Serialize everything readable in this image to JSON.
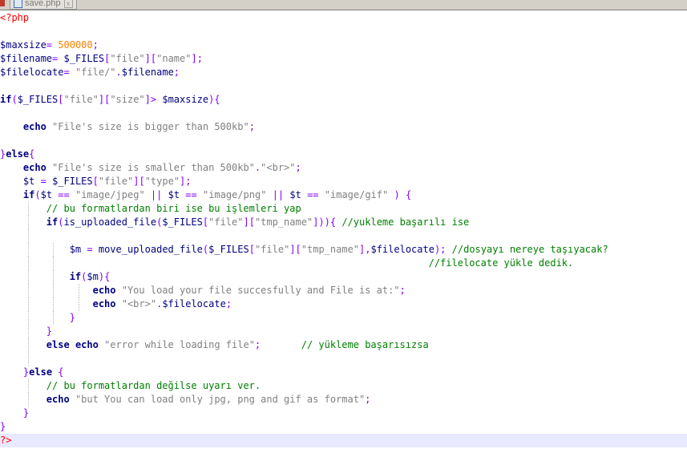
{
  "tab": {
    "filename": "save.php",
    "close_glyph": "x"
  },
  "colors": {
    "tag": "#ff0000",
    "variable": "#000080",
    "operator": "#8000ff",
    "number": "#ff8000",
    "string": "#808080",
    "keyword": "#000080",
    "comment": "#008000",
    "current_line": "#e8e8ff"
  },
  "code": {
    "lines": [
      [
        [
          "tag",
          "<?php"
        ]
      ],
      [],
      [
        [
          "var",
          "$maxsize"
        ],
        [
          "op",
          "="
        ],
        [
          "text",
          " "
        ],
        [
          "num",
          "500000"
        ],
        [
          "op",
          ";"
        ]
      ],
      [
        [
          "var",
          "$filename"
        ],
        [
          "op",
          "="
        ],
        [
          "text",
          " "
        ],
        [
          "var",
          "$_FILES"
        ],
        [
          "op",
          "["
        ],
        [
          "str",
          "\"file\""
        ],
        [
          "op",
          "]["
        ],
        [
          "str",
          "\"name\""
        ],
        [
          "op",
          "];"
        ]
      ],
      [
        [
          "var",
          "$filelocate"
        ],
        [
          "op",
          "="
        ],
        [
          "text",
          " "
        ],
        [
          "str",
          "\"file/\""
        ],
        [
          "op",
          "."
        ],
        [
          "var",
          "$filename"
        ],
        [
          "op",
          ";"
        ]
      ],
      [],
      [
        [
          "kw",
          "if"
        ],
        [
          "op",
          "("
        ],
        [
          "var",
          "$_FILES"
        ],
        [
          "op",
          "["
        ],
        [
          "str",
          "\"file\""
        ],
        [
          "op",
          "]["
        ],
        [
          "str",
          "\"size\""
        ],
        [
          "op",
          "]>"
        ],
        [
          "text",
          " "
        ],
        [
          "var",
          "$maxsize"
        ],
        [
          "op",
          "){"
        ]
      ],
      [],
      [
        [
          "text",
          "    "
        ],
        [
          "kw",
          "echo"
        ],
        [
          "text",
          " "
        ],
        [
          "str",
          "\"File's size is bigger than 500kb\""
        ],
        [
          "op",
          ";"
        ]
      ],
      [],
      [
        [
          "op",
          "}"
        ],
        [
          "kw",
          "else"
        ],
        [
          "op",
          "{"
        ]
      ],
      [
        [
          "text",
          "    "
        ],
        [
          "kw",
          "echo"
        ],
        [
          "text",
          " "
        ],
        [
          "str",
          "\"File's size is smaller than 500kb\""
        ],
        [
          "op",
          "."
        ],
        [
          "str",
          "\"<br>\""
        ],
        [
          "op",
          ";"
        ]
      ],
      [
        [
          "text",
          "    "
        ],
        [
          "var",
          "$t"
        ],
        [
          "text",
          " "
        ],
        [
          "op",
          "="
        ],
        [
          "text",
          " "
        ],
        [
          "var",
          "$_FILES"
        ],
        [
          "op",
          "["
        ],
        [
          "str",
          "\"file\""
        ],
        [
          "op",
          "]["
        ],
        [
          "str",
          "\"type\""
        ],
        [
          "op",
          "];"
        ]
      ],
      [
        [
          "text",
          "    "
        ],
        [
          "kw",
          "if"
        ],
        [
          "op",
          "("
        ],
        [
          "var",
          "$t"
        ],
        [
          "text",
          " "
        ],
        [
          "op",
          "=="
        ],
        [
          "text",
          " "
        ],
        [
          "str",
          "\"image/jpeg\""
        ],
        [
          "text",
          " "
        ],
        [
          "op",
          "||"
        ],
        [
          "text",
          " "
        ],
        [
          "var",
          "$t"
        ],
        [
          "text",
          " "
        ],
        [
          "op",
          "=="
        ],
        [
          "text",
          " "
        ],
        [
          "str",
          "\"image/png\""
        ],
        [
          "text",
          " "
        ],
        [
          "op",
          "||"
        ],
        [
          "text",
          " "
        ],
        [
          "var",
          "$t"
        ],
        [
          "text",
          " "
        ],
        [
          "op",
          "=="
        ],
        [
          "text",
          " "
        ],
        [
          "str",
          "\"image/gif\""
        ],
        [
          "text",
          " "
        ],
        [
          "op",
          ")"
        ],
        [
          "text",
          " "
        ],
        [
          "op",
          "{"
        ]
      ],
      [
        [
          "text",
          "        "
        ],
        [
          "cm",
          "// bu formatlardan biri ise bu işlemleri yap"
        ]
      ],
      [
        [
          "text",
          "        "
        ],
        [
          "kw",
          "if"
        ],
        [
          "op",
          "("
        ],
        [
          "fn",
          "is_uploaded_file"
        ],
        [
          "op",
          "("
        ],
        [
          "var",
          "$_FILES"
        ],
        [
          "op",
          "["
        ],
        [
          "str",
          "\"file\""
        ],
        [
          "op",
          "]["
        ],
        [
          "str",
          "\"tmp_name\""
        ],
        [
          "op",
          "]))"
        ],
        [
          "op",
          "{"
        ],
        [
          "text",
          " "
        ],
        [
          "cm",
          "//yukleme başarılı ise"
        ]
      ],
      [],
      [
        [
          "text",
          "            "
        ],
        [
          "var",
          "$m"
        ],
        [
          "text",
          " "
        ],
        [
          "op",
          "="
        ],
        [
          "text",
          " "
        ],
        [
          "fn",
          "move_uploaded_file"
        ],
        [
          "op",
          "("
        ],
        [
          "var",
          "$_FILES"
        ],
        [
          "op",
          "["
        ],
        [
          "str",
          "\"file\""
        ],
        [
          "op",
          "]["
        ],
        [
          "str",
          "\"tmp_name\""
        ],
        [
          "op",
          "],"
        ],
        [
          "var",
          "$filelocate"
        ],
        [
          "op",
          ");"
        ],
        [
          "text",
          " "
        ],
        [
          "cm",
          "//dosyayı nereye taşıyacak?"
        ]
      ],
      [
        [
          "text",
          "                                                                          "
        ],
        [
          "cm",
          "//filelocate yükle dedik."
        ]
      ],
      [
        [
          "text",
          "            "
        ],
        [
          "kw",
          "if"
        ],
        [
          "op",
          "("
        ],
        [
          "var",
          "$m"
        ],
        [
          "op",
          "){"
        ]
      ],
      [
        [
          "text",
          "                "
        ],
        [
          "kw",
          "echo"
        ],
        [
          "text",
          " "
        ],
        [
          "str",
          "\"You load your file succesfully and File is at:\""
        ],
        [
          "op",
          ";"
        ]
      ],
      [
        [
          "text",
          "                "
        ],
        [
          "kw",
          "echo"
        ],
        [
          "text",
          " "
        ],
        [
          "str",
          "\"<br>\""
        ],
        [
          "op",
          "."
        ],
        [
          "var",
          "$filelocate"
        ],
        [
          "op",
          ";"
        ]
      ],
      [
        [
          "text",
          "            "
        ],
        [
          "op",
          "}"
        ]
      ],
      [
        [
          "text",
          "        "
        ],
        [
          "op",
          "}"
        ]
      ],
      [
        [
          "text",
          "        "
        ],
        [
          "kw",
          "else"
        ],
        [
          "text",
          " "
        ],
        [
          "kw",
          "echo"
        ],
        [
          "text",
          " "
        ],
        [
          "str",
          "\"error while loading file\""
        ],
        [
          "op",
          ";"
        ],
        [
          "text",
          "       "
        ],
        [
          "cm",
          "// yükleme başarısızsa"
        ]
      ],
      [],
      [
        [
          "text",
          "    "
        ],
        [
          "op",
          "}"
        ],
        [
          "kw",
          "else"
        ],
        [
          "text",
          " "
        ],
        [
          "op",
          "{"
        ]
      ],
      [
        [
          "text",
          "        "
        ],
        [
          "cm",
          "// bu formatlardan değilse uyarı ver."
        ]
      ],
      [
        [
          "text",
          "        "
        ],
        [
          "kw",
          "echo"
        ],
        [
          "text",
          " "
        ],
        [
          "str",
          "\"but You can load only jpg, png and gif as format\""
        ],
        [
          "op",
          ";"
        ]
      ],
      [
        [
          "text",
          "    "
        ],
        [
          "op",
          "}"
        ]
      ],
      [
        [
          "op",
          "}"
        ]
      ],
      [
        [
          "tag",
          "?>"
        ]
      ]
    ],
    "current_line": 31
  }
}
